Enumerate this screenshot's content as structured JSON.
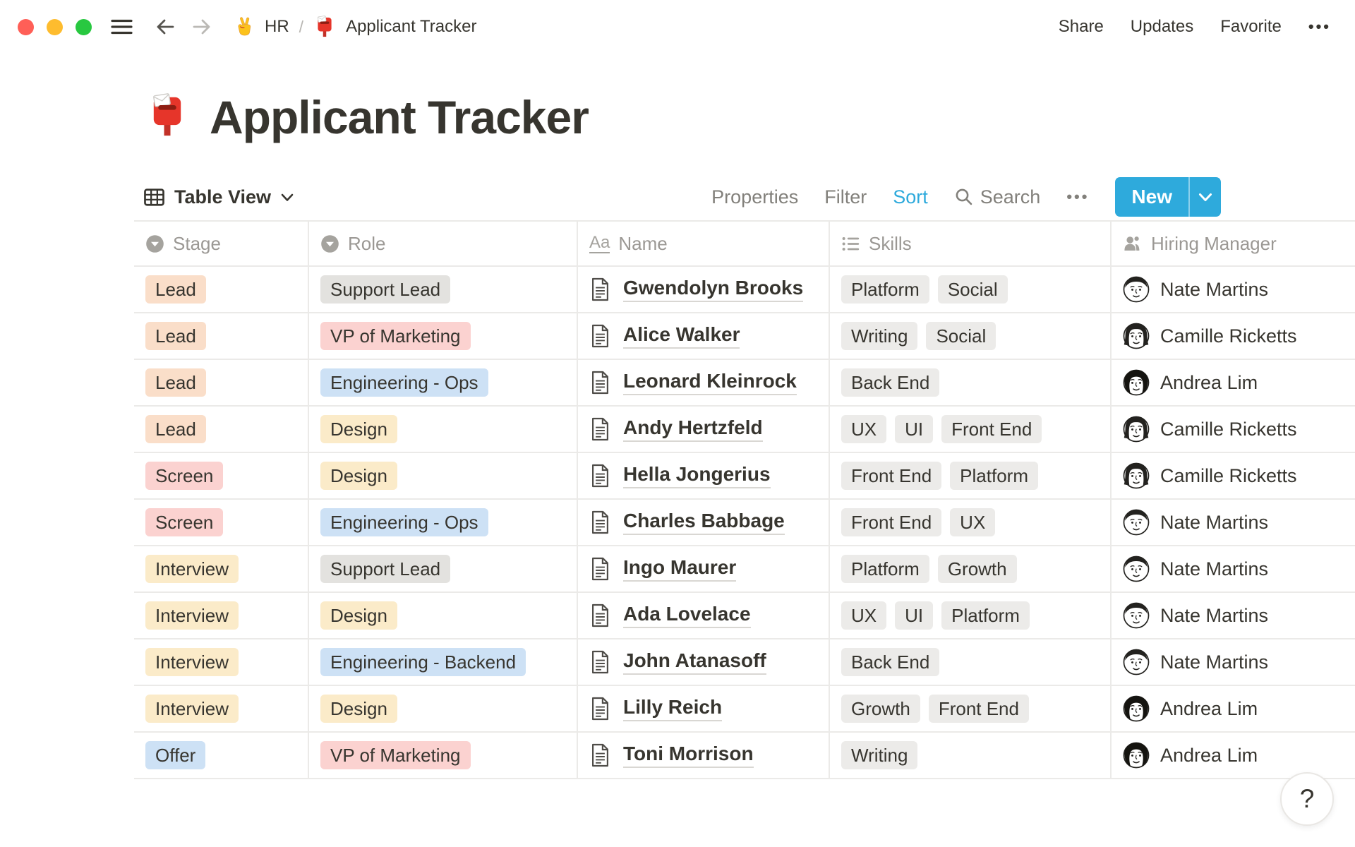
{
  "topbar": {
    "section_emoji_icon": "victory-hand-icon",
    "section_label": "HR",
    "breadcrumb_separator": "/",
    "page_emoji_icon": "postbox-icon",
    "page_label": "Applicant Tracker",
    "nav_icons": [
      "hamburger-icon",
      "back-icon",
      "forward-icon"
    ],
    "actions": {
      "share": "Share",
      "updates": "Updates",
      "favorite": "Favorite",
      "more": "•••"
    }
  },
  "page": {
    "emoji_icon": "postbox-icon",
    "title": "Applicant Tracker"
  },
  "toolbar": {
    "view_icon": "table-grid-icon",
    "view_label": "Table View",
    "properties": "Properties",
    "filter": "Filter",
    "sort": "Sort",
    "search_icon": "search-icon",
    "search": "Search",
    "more": "•••",
    "new_label": "New"
  },
  "table": {
    "columns": [
      {
        "id": "stage",
        "label": "Stage",
        "icon": "select-icon"
      },
      {
        "id": "role",
        "label": "Role",
        "icon": "select-icon"
      },
      {
        "id": "name",
        "label": "Name",
        "icon": "text-icon"
      },
      {
        "id": "skills",
        "label": "Skills",
        "icon": "multiselect-icon"
      },
      {
        "id": "manager",
        "label": "Hiring Manager",
        "icon": "person-icon"
      }
    ],
    "rows": [
      {
        "stage": {
          "label": "Lead",
          "color": "orange"
        },
        "role": {
          "label": "Support Lead",
          "color": "gray"
        },
        "name": "Gwendolyn Brooks",
        "skills": [
          "Platform",
          "Social"
        ],
        "manager": {
          "name": "Nate Martins",
          "avatar": "nate"
        }
      },
      {
        "stage": {
          "label": "Lead",
          "color": "orange"
        },
        "role": {
          "label": "VP of Marketing",
          "color": "pink"
        },
        "name": "Alice Walker",
        "skills": [
          "Writing",
          "Social"
        ],
        "manager": {
          "name": "Camille Ricketts",
          "avatar": "camille"
        }
      },
      {
        "stage": {
          "label": "Lead",
          "color": "orange"
        },
        "role": {
          "label": "Engineering - Ops",
          "color": "blue"
        },
        "name": "Leonard Kleinrock",
        "skills": [
          "Back End"
        ],
        "manager": {
          "name": "Andrea Lim",
          "avatar": "andrea"
        }
      },
      {
        "stage": {
          "label": "Lead",
          "color": "orange"
        },
        "role": {
          "label": "Design",
          "color": "yellow"
        },
        "name": "Andy Hertzfeld",
        "skills": [
          "UX",
          "UI",
          "Front End"
        ],
        "manager": {
          "name": "Camille Ricketts",
          "avatar": "camille"
        }
      },
      {
        "stage": {
          "label": "Screen",
          "color": "pink"
        },
        "role": {
          "label": "Design",
          "color": "yellow"
        },
        "name": "Hella Jongerius",
        "skills": [
          "Front End",
          "Platform"
        ],
        "manager": {
          "name": "Camille Ricketts",
          "avatar": "camille"
        }
      },
      {
        "stage": {
          "label": "Screen",
          "color": "pink"
        },
        "role": {
          "label": "Engineering - Ops",
          "color": "blue"
        },
        "name": "Charles Babbage",
        "skills": [
          "Front End",
          "UX"
        ],
        "manager": {
          "name": "Nate Martins",
          "avatar": "nate"
        }
      },
      {
        "stage": {
          "label": "Interview",
          "color": "yellow"
        },
        "role": {
          "label": "Support Lead",
          "color": "gray"
        },
        "name": "Ingo Maurer",
        "skills": [
          "Platform",
          "Growth"
        ],
        "manager": {
          "name": "Nate Martins",
          "avatar": "nate"
        }
      },
      {
        "stage": {
          "label": "Interview",
          "color": "yellow"
        },
        "role": {
          "label": "Design",
          "color": "yellow"
        },
        "name": "Ada Lovelace",
        "skills": [
          "UX",
          "UI",
          "Platform"
        ],
        "manager": {
          "name": "Nate Martins",
          "avatar": "nate"
        }
      },
      {
        "stage": {
          "label": "Interview",
          "color": "yellow"
        },
        "role": {
          "label": "Engineering - Backend",
          "color": "blue"
        },
        "name": "John Atanasoff",
        "skills": [
          "Back End"
        ],
        "manager": {
          "name": "Nate Martins",
          "avatar": "nate"
        }
      },
      {
        "stage": {
          "label": "Interview",
          "color": "yellow"
        },
        "role": {
          "label": "Design",
          "color": "yellow"
        },
        "name": "Lilly Reich",
        "skills": [
          "Growth",
          "Front End"
        ],
        "manager": {
          "name": "Andrea Lim",
          "avatar": "andrea"
        }
      },
      {
        "stage": {
          "label": "Offer",
          "color": "blue"
        },
        "role": {
          "label": "VP of Marketing",
          "color": "pink"
        },
        "name": "Toni Morrison",
        "skills": [
          "Writing"
        ],
        "manager": {
          "name": "Andrea Lim",
          "avatar": "andrea"
        }
      }
    ]
  },
  "help_label": "?",
  "colors": {
    "accent_blue": "#2EAADC",
    "text_dark": "#37352F",
    "tag_orange": "#FADEC9",
    "tag_pink": "#FBD2D0",
    "tag_yellow": "#FBEBC9",
    "tag_blue": "#CDE1F5",
    "tag_gray": "#E3E2DF",
    "tag_lightgray": "#ECEBE9",
    "traffic_red": "#FF5F57",
    "traffic_yellow": "#FEBC2E",
    "traffic_green": "#28C840"
  }
}
